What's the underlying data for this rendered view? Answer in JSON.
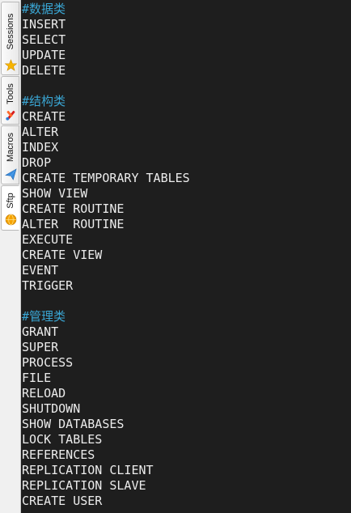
{
  "sidebar": {
    "tabs": [
      {
        "label": "Sessions",
        "icon": "star-icon",
        "active": false
      },
      {
        "label": "Tools",
        "icon": "tools-icon",
        "active": false
      },
      {
        "label": "Macros",
        "icon": "paper-plane-icon",
        "active": false
      },
      {
        "label": "Sftp",
        "icon": "sftp-globe-icon",
        "active": true
      }
    ]
  },
  "colors": {
    "terminal_bg": "#1e1e1e",
    "text": "#ececec",
    "comment": "#3aa6d4"
  },
  "terminal": {
    "lines": [
      {
        "text": "#数据类",
        "type": "comment"
      },
      {
        "text": "INSERT",
        "type": "text"
      },
      {
        "text": "SELECT",
        "type": "text"
      },
      {
        "text": "UPDATE",
        "type": "text"
      },
      {
        "text": "DELETE",
        "type": "text"
      },
      {
        "text": "",
        "type": "blank"
      },
      {
        "text": "#结构类",
        "type": "comment"
      },
      {
        "text": "CREATE",
        "type": "text"
      },
      {
        "text": "ALTER",
        "type": "text"
      },
      {
        "text": "INDEX",
        "type": "text"
      },
      {
        "text": "DROP",
        "type": "text"
      },
      {
        "text": "CREATE TEMPORARY TABLES",
        "type": "text"
      },
      {
        "text": "SHOW VIEW",
        "type": "text"
      },
      {
        "text": "CREATE ROUTINE",
        "type": "text"
      },
      {
        "text": "ALTER  ROUTINE",
        "type": "text"
      },
      {
        "text": "EXECUTE",
        "type": "text"
      },
      {
        "text": "CREATE VIEW",
        "type": "text"
      },
      {
        "text": "EVENT",
        "type": "text"
      },
      {
        "text": "TRIGGER",
        "type": "text"
      },
      {
        "text": "",
        "type": "blank"
      },
      {
        "text": "#管理类",
        "type": "comment"
      },
      {
        "text": "GRANT",
        "type": "text"
      },
      {
        "text": "SUPER",
        "type": "text"
      },
      {
        "text": "PROCESS",
        "type": "text"
      },
      {
        "text": "FILE",
        "type": "text"
      },
      {
        "text": "RELOAD",
        "type": "text"
      },
      {
        "text": "SHUTDOWN",
        "type": "text"
      },
      {
        "text": "SHOW DATABASES",
        "type": "text"
      },
      {
        "text": "LOCK TABLES",
        "type": "text"
      },
      {
        "text": "REFERENCES",
        "type": "text"
      },
      {
        "text": "REPLICATION CLIENT",
        "type": "text"
      },
      {
        "text": "REPLICATION SLAVE",
        "type": "text"
      },
      {
        "text": "CREATE USER",
        "type": "text"
      }
    ]
  }
}
